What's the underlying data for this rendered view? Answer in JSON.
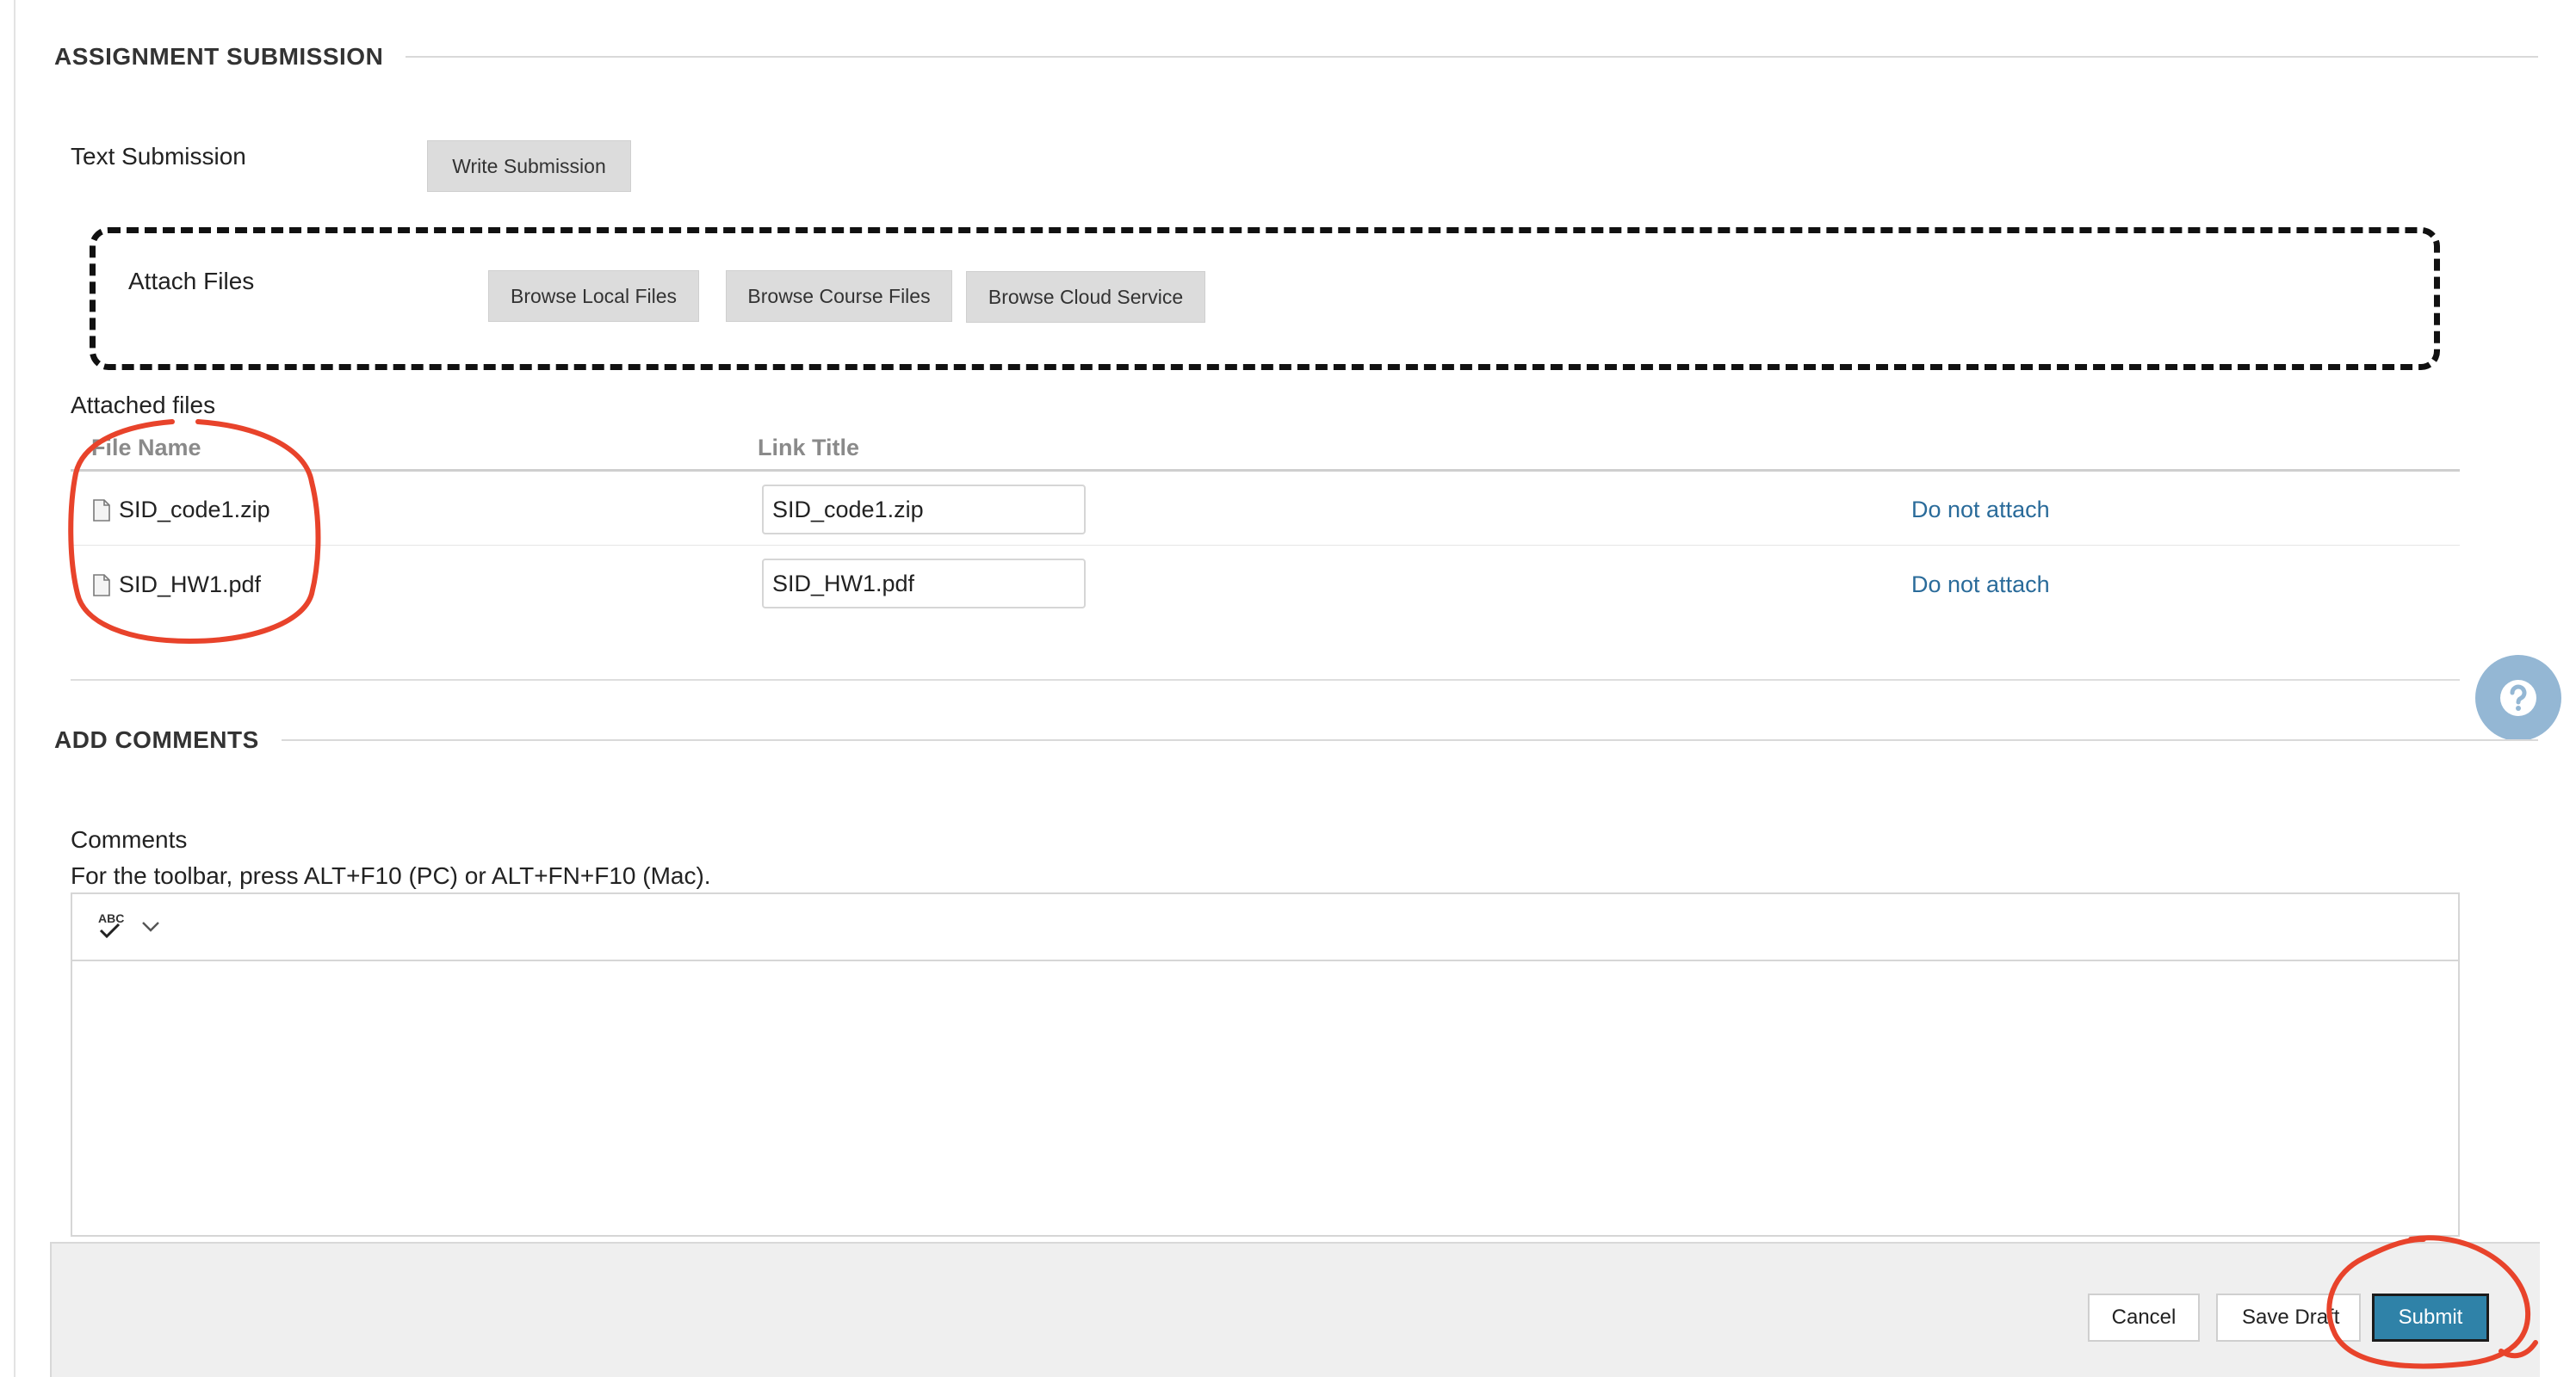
{
  "assignment_submission": {
    "heading": "ASSIGNMENT SUBMISSION",
    "text_submission_label": "Text Submission",
    "write_submission_button": "Write Submission",
    "attach_files_label": "Attach Files",
    "browse_local_button": "Browse Local Files",
    "browse_course_button": "Browse Course Files",
    "browse_cloud_button": "Browse Cloud Service",
    "attached_files_label": "Attached files",
    "table": {
      "headers": {
        "file_name": "File Name",
        "link_title": "Link Title"
      },
      "rows": [
        {
          "file_name": "SID_code1.zip",
          "link_title": "SID_code1.zip",
          "action": "Do not attach"
        },
        {
          "file_name": "SID_HW1.pdf",
          "link_title": "SID_HW1.pdf",
          "action": "Do not attach"
        }
      ]
    }
  },
  "add_comments": {
    "heading": "ADD COMMENTS",
    "comments_label": "Comments",
    "toolbar_hint": "For the toolbar, press ALT+F10 (PC) or ALT+FN+F10 (Mac).",
    "spellcheck_icon_text": "ABC"
  },
  "footer": {
    "cancel_label": "Cancel",
    "save_draft_label": "Save Draft",
    "submit_label": "Submit"
  },
  "colors": {
    "link": "#2a6b9a",
    "submit_bg": "#2f82a8",
    "annotation_red": "#e8432b",
    "help_bg": "#94b7d4"
  },
  "icons": [
    "file-icon",
    "spellcheck-icon",
    "chevron-down-icon",
    "help-question-icon"
  ]
}
